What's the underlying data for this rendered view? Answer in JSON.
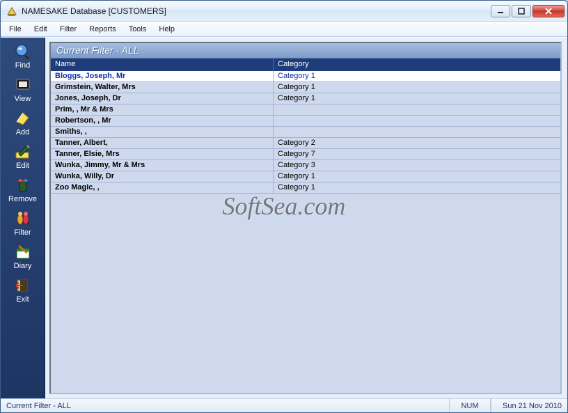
{
  "window": {
    "title": "NAMESAKE Database  [CUSTOMERS]"
  },
  "menu": {
    "file": "File",
    "edit": "Edit",
    "filter": "Filter",
    "reports": "Reports",
    "tools": "Tools",
    "help": "Help"
  },
  "sidebar": {
    "find": "Find",
    "view": "View",
    "add": "Add",
    "edit": "Edit",
    "remove": "Remove",
    "filter": "Filter",
    "diary": "Diary",
    "exit": "Exit"
  },
  "panel": {
    "filter_title": "Current Filter - ALL",
    "columns": {
      "name": "Name",
      "category": "Category"
    },
    "rows": [
      {
        "name": "Bloggs, Joseph, Mr",
        "category": "Category 1",
        "selected": true
      },
      {
        "name": "Grimstein, Walter, Mrs",
        "category": "Category 1"
      },
      {
        "name": "Jones, Joseph, Dr",
        "category": "Category 1"
      },
      {
        "name": "Prim, , Mr & Mrs",
        "category": ""
      },
      {
        "name": "Robertson, , Mr",
        "category": ""
      },
      {
        "name": "Smiths, ,",
        "category": ""
      },
      {
        "name": "Tanner, Albert,",
        "category": "Category 2"
      },
      {
        "name": "Tanner, Elsie, Mrs",
        "category": "Category 7"
      },
      {
        "name": "Wunka, Jimmy, Mr & Mrs",
        "category": "Category 3"
      },
      {
        "name": "Wunka, Willy, Dr",
        "category": "Category 1"
      },
      {
        "name": "Zoo Magic, ,",
        "category": "Category 1"
      }
    ]
  },
  "status": {
    "left": "Current Filter - ALL",
    "num": "NUM",
    "date": "Sun 21 Nov 2010"
  },
  "watermark": "SoftSea.com"
}
